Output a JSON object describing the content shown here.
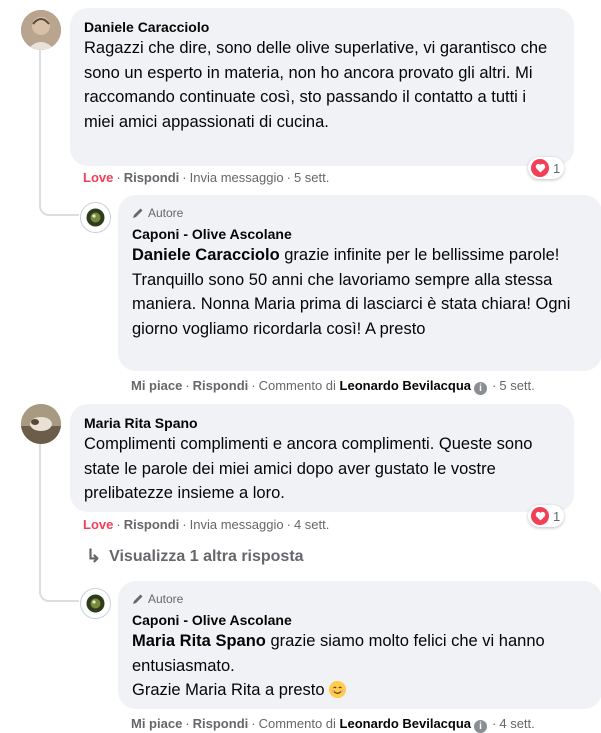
{
  "colors": {
    "love": "#f33e58",
    "muted": "#65676b",
    "bubble": "#f0f2f5"
  },
  "comments": [
    {
      "author": "Daniele Caracciolo",
      "text": "Ragazzi che dire, sono delle olive superlative, vi garantisco che sono un esperto in materia, non ho ancora provato gli altri. Mi raccomando continuate così, sto passando il contatto a tutti i miei amici appassionati di cucina.",
      "reaction_label": "Love",
      "reply_label": "Rispondi",
      "message_label": "Invia messaggio",
      "time": "5 sett.",
      "reaction_count": "1",
      "reaction_icon": "heart-icon"
    },
    {
      "author": "Maria Rita Spano",
      "text": "Complimenti complimenti e ancora complimenti. Queste sono state le parole dei miei amici dopo aver gustato le vostre prelibatezze insieme a loro.",
      "reaction_label": "Love",
      "reply_label": "Rispondi",
      "message_label": "Invia messaggio",
      "time": "4 sett.",
      "reaction_count": "1",
      "reaction_icon": "heart-icon"
    }
  ],
  "replies": [
    {
      "badge": "Autore",
      "author": "Caponi - Olive Ascolane",
      "mention": "Daniele Caracciolo",
      "text": " grazie infinite per le bellissime parole! Tranquillo sono 50 anni che lavoriamo sempre alla stessa maniera. Nonna Maria prima di lasciarci è stata chiara! Ogni giorno vogliamo ricordarla così! A presto",
      "like_label": "Mi piace",
      "reply_label": "Rispondi",
      "comment_by_label": "Commento di",
      "comment_by": "Leonardo Bevilacqua",
      "time": "5 sett."
    },
    {
      "badge": "Autore",
      "author": "Caponi - Olive Ascolane",
      "mention": "Maria Rita Spano",
      "text": " grazie siamo molto felici che vi hanno entusiasmato.",
      "text2": "Grazie Maria Rita a presto",
      "like_label": "Mi piace",
      "reply_label": "Rispondi",
      "comment_by_label": "Commento di",
      "comment_by": "Leonardo Bevilacqua",
      "time": "4 sett."
    }
  ],
  "more_replies_label": "Visualizza 1 altra risposta",
  "separator": "·"
}
